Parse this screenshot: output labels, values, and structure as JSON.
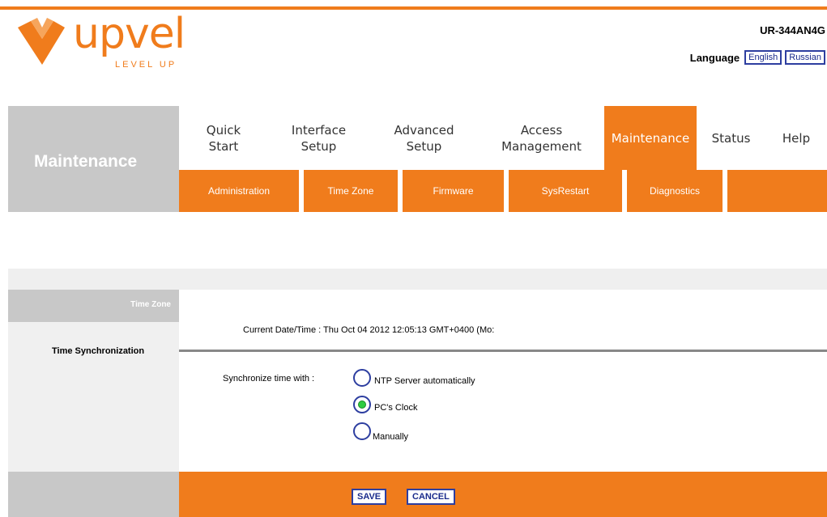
{
  "brand": {
    "name": "upvel",
    "tagline": "LEVEL UP",
    "accent": "#f07c1c"
  },
  "header": {
    "model": "UR-344AN4G",
    "language_label": "Language",
    "languages": [
      "English",
      "Russian"
    ]
  },
  "section_title": "Maintenance",
  "tabs": [
    {
      "label": "Quick\nStart",
      "line1": "Quick",
      "line2": "Start",
      "active": false
    },
    {
      "line1": "Interface",
      "line2": "Setup",
      "active": false
    },
    {
      "line1": "Advanced",
      "line2": "Setup",
      "active": false
    },
    {
      "line1": "Access",
      "line2": "Management",
      "active": false
    },
    {
      "line1": "Maintenance",
      "line2": "",
      "active": true
    },
    {
      "line1": "Status",
      "line2": "",
      "active": false
    },
    {
      "line1": "Help",
      "line2": "",
      "active": false
    }
  ],
  "subtabs": [
    "Administration",
    "Time Zone",
    "Firmware",
    "SysRestart",
    "Diagnostics"
  ],
  "page": {
    "section_header": "Time Zone",
    "left_label": "Time Synchronization",
    "current_time": "Current Date/Time : Thu Oct 04 2012 12:05:13 GMT+0400 (Mo:",
    "sync_label": "Synchronize time with :",
    "options": [
      {
        "label": "NTP Server automatically",
        "checked": false
      },
      {
        "label": "PC's Clock",
        "checked": true
      },
      {
        "label": "Manually",
        "checked": false
      }
    ]
  },
  "footer": {
    "save_label": "SAVE",
    "cancel_label": "CANCEL"
  }
}
